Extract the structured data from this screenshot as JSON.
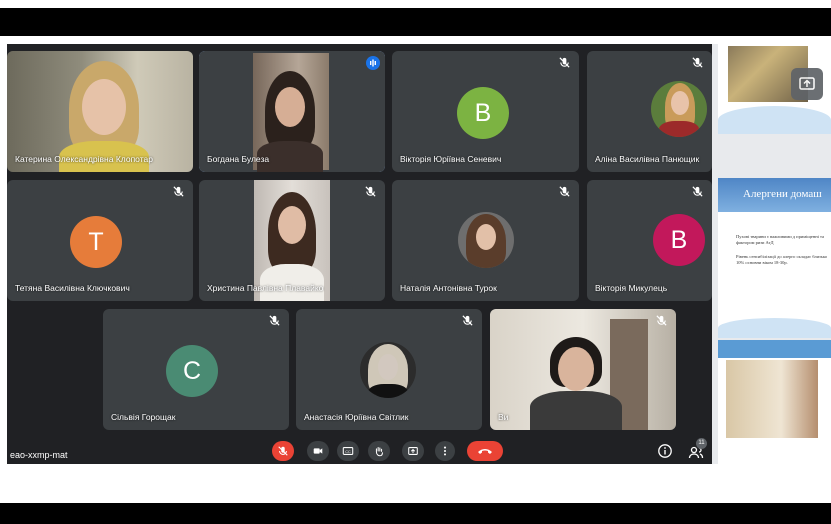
{
  "meeting": {
    "code": "eao-xxmp-mat",
    "people_count": "11"
  },
  "participants": [
    {
      "name": "Катерина Олександрівна Клопотар",
      "type": "video"
    },
    {
      "name": "Богдана Булеза",
      "type": "video",
      "speaking": true
    },
    {
      "name": "Вікторія Юріївна Сеневич",
      "type": "avatar",
      "letter": "В",
      "color": "#7cb342"
    },
    {
      "name": "Аліна Василівна Панющик",
      "type": "photo"
    },
    {
      "name": "Тетяна Василівна Ключкович",
      "type": "avatar",
      "letter": "Т",
      "color": "#e67c3a"
    },
    {
      "name": "Христина Павлівна Плавайко",
      "type": "video"
    },
    {
      "name": "Наталія Антонівна Турок",
      "type": "photo"
    },
    {
      "name": "Вікторія Микулець",
      "type": "avatar",
      "letter": "В",
      "color": "#c2185b"
    },
    {
      "name": "Сільвія Горощак",
      "type": "avatar",
      "letter": "С",
      "color": "#4a8b73"
    },
    {
      "name": "Анастасія Юріївна Світлик",
      "type": "photo"
    },
    {
      "name": "Ви",
      "type": "video"
    }
  ],
  "slides": {
    "slide2_title": "Алергени домаш",
    "slide2_bullets": [
      "Пухові тварини є важливими д приміщенні та фактором ризи АтД",
      "Рівень сенсибілізації до алерго складає близько 10% основни віком 18-30р."
    ]
  },
  "icons": {
    "mic": "mic-off-icon",
    "camera": "camera-icon",
    "captions": "captions-icon",
    "hand": "raise-hand-icon",
    "present": "present-icon",
    "more": "more-vert-icon",
    "hangup": "hangup-icon",
    "info": "info-icon",
    "people": "people-icon"
  },
  "colors": {
    "meet_bg": "#202124",
    "tile_bg": "#3c4043",
    "accent": "#8ab4f8",
    "hangup": "#ea4335"
  }
}
